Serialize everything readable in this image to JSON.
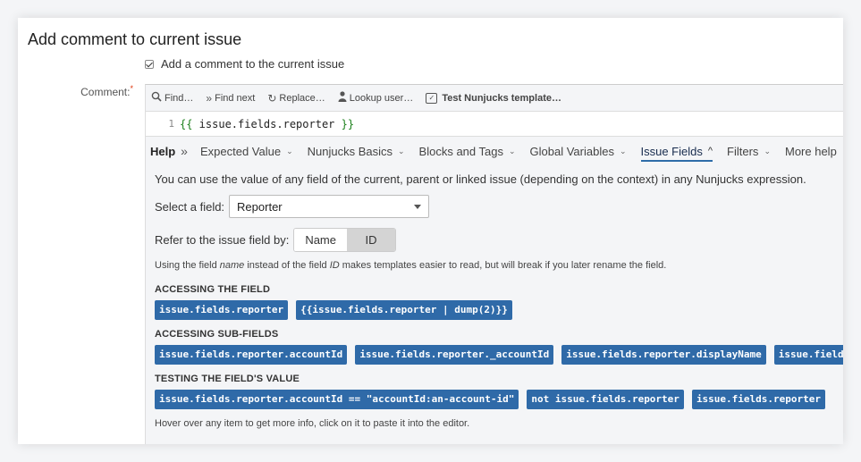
{
  "page": {
    "title": "Add comment to current issue"
  },
  "add_comment": {
    "label": "Add a comment to the current issue",
    "checked": true
  },
  "comment_field": {
    "label": "Comment:",
    "required_mark": "*"
  },
  "toolbar": {
    "find": "Find…",
    "find_next": "Find next",
    "replace": "Replace…",
    "lookup_user": "Lookup user…",
    "test_template": "Test Nunjucks template…"
  },
  "editor": {
    "line_number": "1",
    "open": "{{",
    "expr": " issue.fields.reporter ",
    "close": "}}"
  },
  "help_tabs": {
    "help": "Help",
    "chevrons": "»",
    "items": [
      {
        "label": "Expected Value"
      },
      {
        "label": "Nunjucks Basics"
      },
      {
        "label": "Blocks and Tags"
      },
      {
        "label": "Global Variables"
      },
      {
        "label": "Issue Fields"
      },
      {
        "label": "Filters"
      },
      {
        "label": "More help"
      }
    ],
    "active": "Issue Fields"
  },
  "help_body": {
    "intro": "You can use the value of any field of the current, parent or linked issue (depending on the context) in any Nunjucks expression.",
    "select_label": "Select a field:",
    "select_value": "Reporter",
    "refer_label": "Refer to the issue field by:",
    "refer_name": "Name",
    "refer_id": "ID",
    "note_a": "Using the field ",
    "note_name": "name",
    "note_b": " instead of the field ",
    "note_id": "ID",
    "note_c": " makes templates easier to read, but will break if you later rename the field.",
    "accessing_heading": "ACCESSING THE FIELD",
    "accessing_chips": [
      "issue.fields.reporter",
      "{{issue.fields.reporter | dump(2)}}"
    ],
    "sub_heading": "ACCESSING SUB-FIELDS",
    "sub_chips": [
      "issue.fields.reporter.accountId",
      "issue.fields.reporter._accountId",
      "issue.fields.reporter.displayName",
      "issue.fields.re"
    ],
    "testing_heading": "TESTING THE FIELD'S VALUE",
    "testing_chips": [
      "issue.fields.reporter.accountId == \"accountId:an-account-id\"",
      "not issue.fields.reporter",
      "issue.fields.reporter"
    ],
    "hover_note": "Hover over any item to get more info, click on it to paste it into the editor."
  }
}
